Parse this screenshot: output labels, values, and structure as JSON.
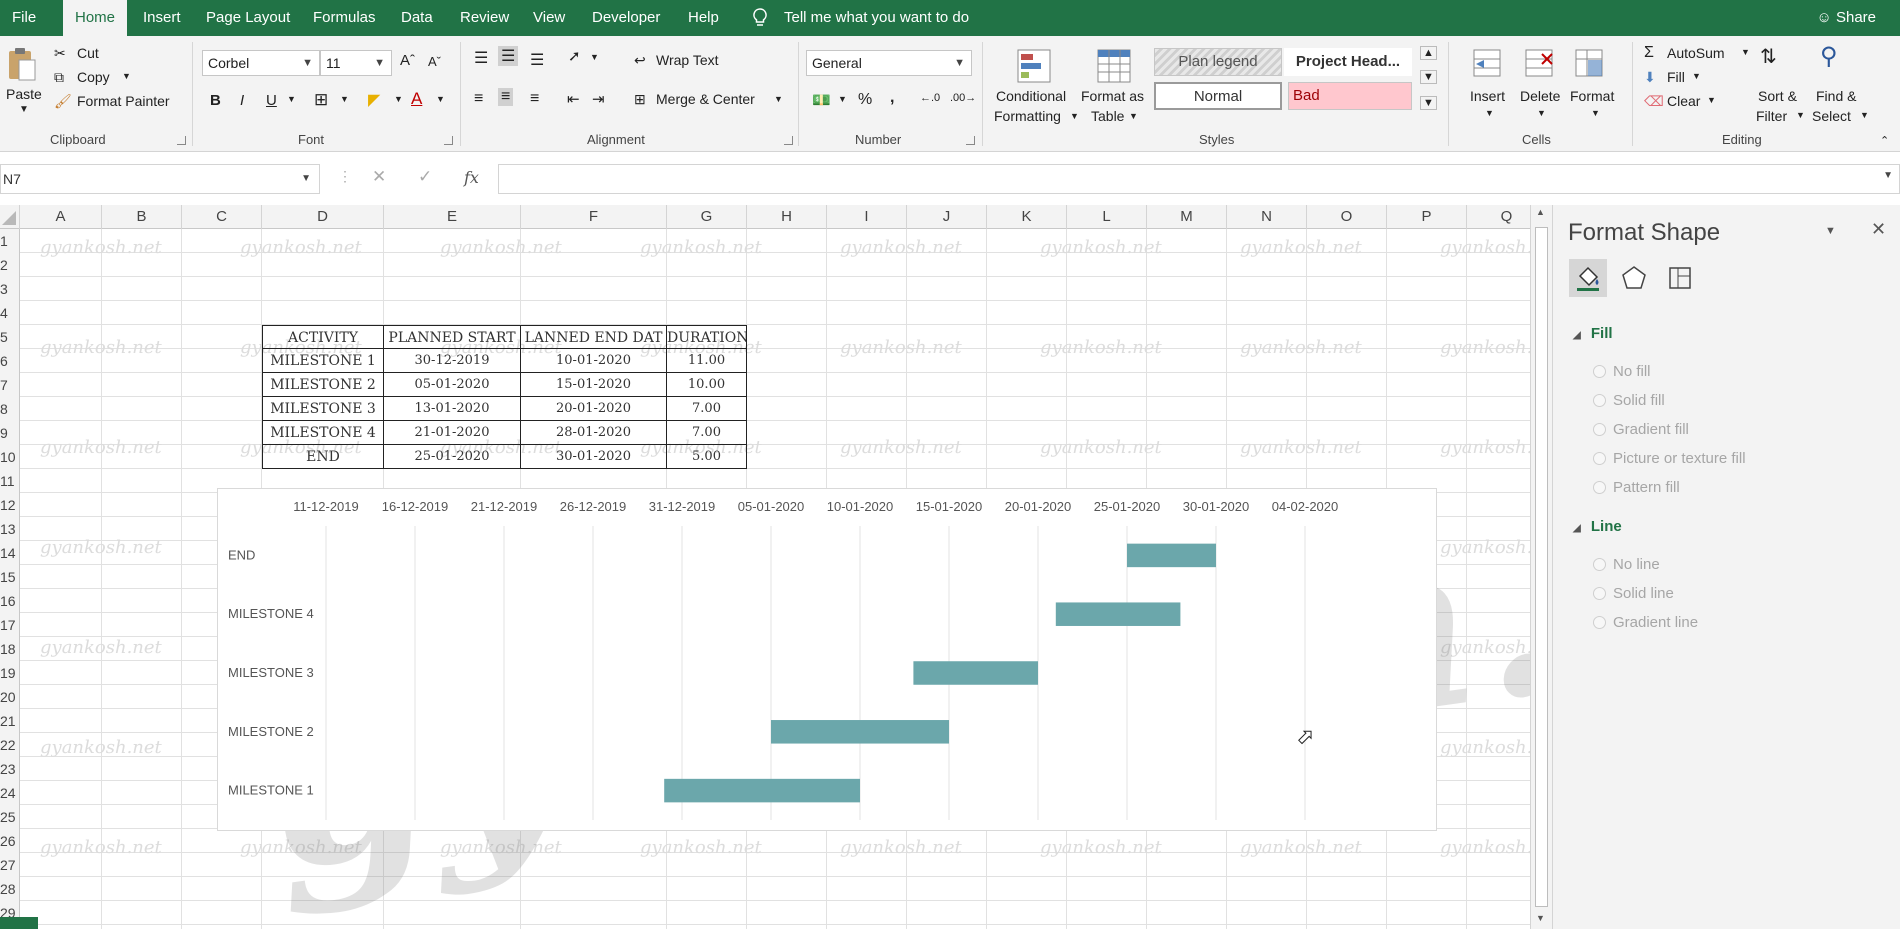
{
  "menu": {
    "tabs": [
      "File",
      "Home",
      "Insert",
      "Page Layout",
      "Formulas",
      "Data",
      "Review",
      "View",
      "Developer",
      "Help"
    ],
    "active_tab": "Home",
    "tell_me": "Tell me what you want to do",
    "share": "Share"
  },
  "ribbon": {
    "clipboard": {
      "paste": "Paste",
      "cut": "Cut",
      "copy": "Copy",
      "format_painter": "Format Painter",
      "label": "Clipboard"
    },
    "font": {
      "name": "Corbel",
      "size": "11",
      "bold": "B",
      "italic": "I",
      "underline": "U",
      "label": "Font"
    },
    "alignment": {
      "wrap_text": "Wrap Text",
      "merge_center": "Merge & Center",
      "label": "Alignment"
    },
    "number": {
      "format": "General",
      "percent": "%",
      "comma": ",",
      "label": "Number"
    },
    "styles": {
      "conditional_formatting": [
        "Conditional",
        "Formatting"
      ],
      "format_as_table": [
        "Format as",
        "Table"
      ],
      "cells": [
        "Plan legend",
        "Project Head...",
        "Normal",
        "Bad"
      ],
      "label": "Styles"
    },
    "cells": {
      "insert": "Insert",
      "delete": "Delete",
      "format": "Format",
      "label": "Cells"
    },
    "editing": {
      "autosum": "AutoSum",
      "fill": "Fill",
      "clear": "Clear",
      "sort_filter": [
        "Sort &",
        "Filter"
      ],
      "find_select": [
        "Find &",
        "Select"
      ],
      "label": "Editing"
    }
  },
  "formula_bar": {
    "name_box": "N7",
    "fx": "fx",
    "formula": ""
  },
  "sheet": {
    "columns": [
      "A",
      "B",
      "C",
      "D",
      "E",
      "F",
      "G",
      "H",
      "I",
      "J",
      "K",
      "L",
      "M",
      "N",
      "O",
      "P",
      "Q"
    ],
    "rows": [
      "1",
      "2",
      "3",
      "4",
      "5",
      "6",
      "7",
      "8",
      "9",
      "10",
      "11",
      "12",
      "13",
      "14",
      "15",
      "16",
      "17",
      "18",
      "19",
      "20",
      "21",
      "22",
      "23",
      "24",
      "25",
      "26",
      "27",
      "28",
      "29"
    ],
    "table": {
      "headers": [
        "ACTIVITY",
        "PLANNED START",
        "PLANNED END DATE",
        "DURATION"
      ],
      "header_display": [
        "ACTIVITY",
        "PLANNED START",
        "LANNED END DAT",
        "DURATION"
      ],
      "rows": [
        [
          "MILESTONE 1",
          "30-12-2019",
          "10-01-2020",
          "11.00"
        ],
        [
          "MILESTONE 2",
          "05-01-2020",
          "15-01-2020",
          "10.00"
        ],
        [
          "MILESTONE 3",
          "13-01-2020",
          "20-01-2020",
          "7.00"
        ],
        [
          "MILESTONE 4",
          "21-01-2020",
          "28-01-2020",
          "7.00"
        ],
        [
          "END",
          "25-01-2020",
          "30-01-2020",
          "5.00"
        ]
      ]
    },
    "watermark": "gyankosh.net",
    "big_watermark": "gyankosh.net"
  },
  "chart_data": {
    "type": "bar",
    "orientation": "horizontal",
    "stacked": true,
    "x_ticks": [
      "11-12-2019",
      "16-12-2019",
      "21-12-2019",
      "26-12-2019",
      "31-12-2019",
      "05-01-2020",
      "10-01-2020",
      "15-01-2020",
      "20-01-2020",
      "25-01-2020",
      "30-01-2020",
      "04-02-2020"
    ],
    "x_axis_position": "top",
    "xlim": [
      "11-12-2019",
      "09-02-2020"
    ],
    "categories": [
      "MILESTONE 1",
      "MILESTONE 2",
      "MILESTONE 3",
      "MILESTONE 4",
      "END"
    ],
    "start": [
      "30-12-2019",
      "05-01-2020",
      "13-01-2020",
      "21-01-2020",
      "25-01-2020"
    ],
    "duration": [
      11,
      10,
      7,
      7,
      5
    ],
    "bar_color": "#6ba7ab",
    "grid": "vertical"
  },
  "format_pane": {
    "title": "Format Shape",
    "fill_section": "Fill",
    "fill_options": [
      "No fill",
      "Solid fill",
      "Gradient fill",
      "Picture or texture fill",
      "Pattern fill"
    ],
    "line_section": "Line",
    "line_options": [
      "No line",
      "Solid line",
      "Gradient line"
    ]
  },
  "colors": {
    "excel_green": "#217346",
    "bar": "#6ba7ab",
    "bad_fill": "#ffc7ce",
    "bad_text": "#9c0006"
  }
}
